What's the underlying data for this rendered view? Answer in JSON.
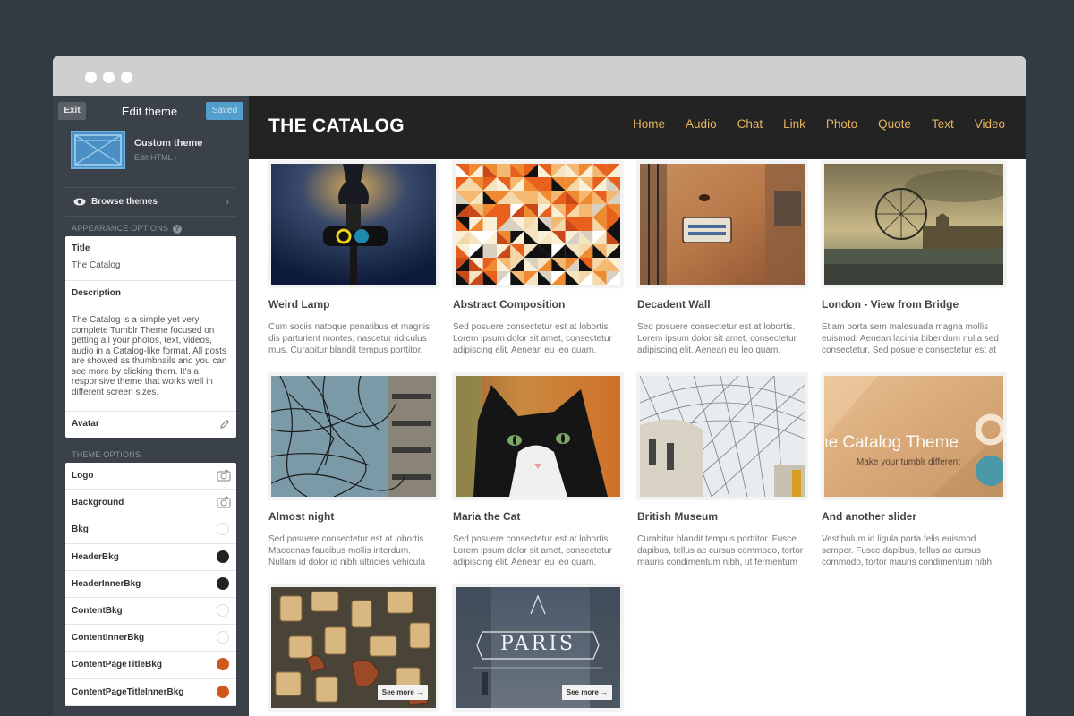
{
  "sidebar": {
    "exit_label": "Exit",
    "title": "Edit theme",
    "saved_label": "Saved",
    "custom_theme": {
      "name": "Custom theme",
      "sub": "Edit HTML ›"
    },
    "browse_label": "Browse themes",
    "appearance_label": "APPEARANCE OPTIONS",
    "title_field": {
      "label": "Title",
      "value": "The Catalog"
    },
    "description_field": {
      "label": "Description",
      "value": "The Catalog is a simple yet very complete Tumblr Theme focused on getting all your photos, text, videos, audio in a Catalog-like format. All posts are showed as thumbnails and you can see more by clicking them. It's a responsive theme that works well in different screen sizes."
    },
    "avatar_label": "Avatar",
    "theme_options_label": "THEME OPTIONS",
    "theme_options": [
      {
        "label": "Logo",
        "kind": "image"
      },
      {
        "label": "Background",
        "kind": "image"
      },
      {
        "label": "Bkg",
        "kind": "color",
        "color": "#ffffff"
      },
      {
        "label": "HeaderBkg",
        "kind": "color",
        "color": "#222222"
      },
      {
        "label": "HeaderInnerBkg",
        "kind": "color",
        "color": "#222222"
      },
      {
        "label": "ContentBkg",
        "kind": "color",
        "color": "#ffffff"
      },
      {
        "label": "ContentInnerBkg",
        "kind": "color",
        "color": "#ffffff"
      },
      {
        "label": "ContentPageTitleBkg",
        "kind": "color",
        "color": "#d0581c"
      },
      {
        "label": "ContentPageTitleInnerBkg",
        "kind": "color",
        "color": "#d0581c"
      }
    ]
  },
  "site": {
    "title": "THE CATALOG",
    "nav": [
      "Home",
      "Audio",
      "Chat",
      "Link",
      "Photo",
      "Quote",
      "Text",
      "Video"
    ],
    "see_more_label": "See more →",
    "posts": [
      {
        "title": "Weird Lamp",
        "lines": [
          "Cum sociis natoque penatibus et magnis",
          "dis parturient montes, nascetur ridiculus",
          "mus. Curabitur blandit tempus porttitor."
        ]
      },
      {
        "title": "Abstract Composition",
        "lines": [
          "Sed posuere consectetur est at lobortis.",
          "Lorem ipsum dolor sit amet, consectetur",
          "adipiscing elit. Aenean eu leo quam."
        ]
      },
      {
        "title": "Decadent Wall",
        "lines": [
          "Sed posuere consectetur est at lobortis.",
          "Lorem ipsum dolor sit amet, consectetur",
          "adipiscing elit. Aenean eu leo quam."
        ]
      },
      {
        "title": "London - View from Bridge",
        "lines": [
          "Etiam porta sem malesuada magna mollis",
          "euismod. Aenean lacinia bibendum nulla sed",
          "consectetur.  Sed posuere consectetur est at"
        ]
      },
      {
        "title": "Almost night",
        "lines": [
          "Sed posuere consectetur est at lobortis.",
          "Maecenas faucibus mollis interdum.",
          "Nullam id dolor id nibh ultricies vehicula"
        ]
      },
      {
        "title": "Maria the Cat",
        "lines": [
          "Sed posuere consectetur est at lobortis.",
          "Lorem ipsum dolor sit amet, consectetur",
          "adipiscing elit. Aenean eu leo quam."
        ]
      },
      {
        "title": "British Museum",
        "lines": [
          "Curabitur blandit tempus porttitor. Fusce",
          "dapibus, tellus ac cursus commodo, tortor",
          "mauris condimentum nibh, ut fermentum"
        ]
      },
      {
        "title": "And another slider",
        "lines": [
          "Vestibulum id ligula porta felis euismod",
          "semper. Fusce dapibus, tellus ac cursus",
          "commodo, tortor mauris condimentum nibh,"
        ]
      }
    ],
    "slider_text": {
      "big": "he Catalog Theme",
      "small": "Make your tumblr different"
    },
    "paris_text": "PARIS"
  }
}
